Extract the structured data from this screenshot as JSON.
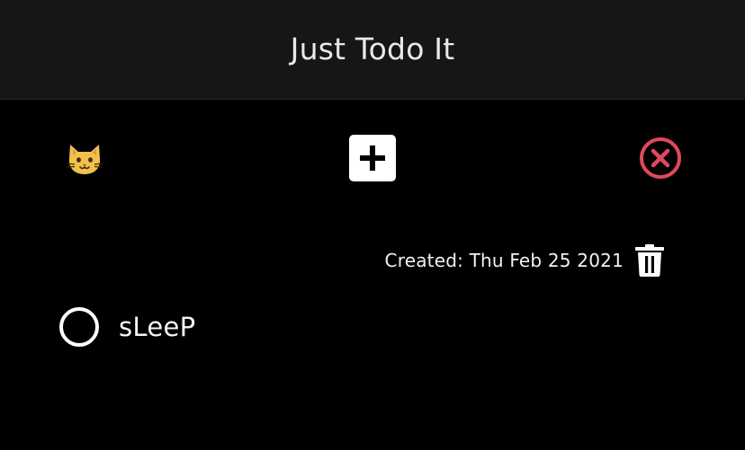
{
  "header": {
    "title": "Just Todo It"
  },
  "toolbar": {
    "cat_icon": "cat-face-icon",
    "add_icon": "plus-icon",
    "close_icon": "close-circle-icon"
  },
  "todo": {
    "created_label": "Created: Thu Feb 25 2021",
    "delete_icon": "trash-icon",
    "items": [
      {
        "label": "sLeeP",
        "completed": false
      }
    ]
  },
  "colors": {
    "background": "#000000",
    "header_background": "#161616",
    "close_accent": "#e0485c",
    "cat_yellow": "#f2c14b"
  }
}
